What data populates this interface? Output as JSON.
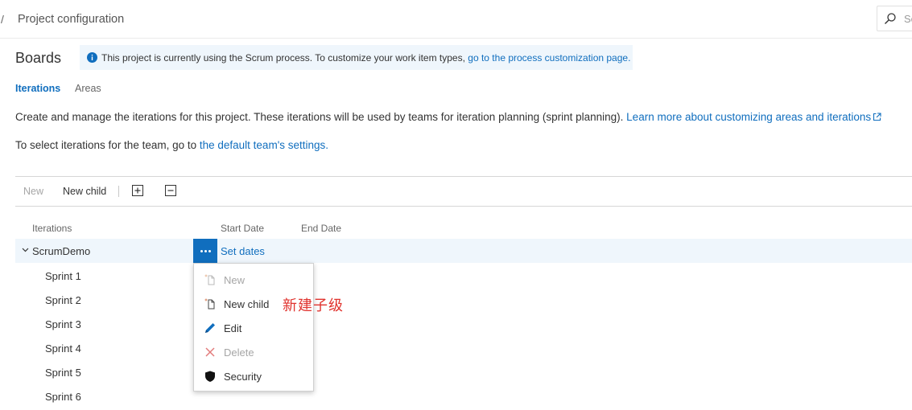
{
  "header": {
    "breadcrumb_separator": "/",
    "title": "Project configuration",
    "search_placeholder": "Se"
  },
  "page_title": "Boards",
  "info_bar": {
    "text": "This project is currently using the Scrum process. To customize your work item types, ",
    "link": "go to the process customization page."
  },
  "tabs": [
    {
      "label": "Iterations",
      "active": true
    },
    {
      "label": "Areas",
      "active": false
    }
  ],
  "description": {
    "line1_text": "Create and manage the iterations for this project. These iterations will be used by teams for iteration planning (sprint planning). ",
    "line1_link": "Learn more about customizing areas and iterations",
    "line2_text": "To select iterations for the team, go to ",
    "line2_link": "the default team's settings."
  },
  "toolbar": {
    "new_label": "New",
    "new_child_label": "New child",
    "expand_icon": "expand-all-icon",
    "collapse_icon": "collapse-all-icon"
  },
  "columns": {
    "iterations": "Iterations",
    "start_date": "Start Date",
    "end_date": "End Date"
  },
  "root": {
    "label": "ScrumDemo",
    "set_dates": "Set dates"
  },
  "sprints": [
    "Sprint 1",
    "Sprint 2",
    "Sprint 3",
    "Sprint 4",
    "Sprint 5",
    "Sprint 6"
  ],
  "context_menu": [
    {
      "label": "New",
      "icon": "new-item-icon",
      "disabled": true
    },
    {
      "label": "New child",
      "icon": "new-child-icon",
      "disabled": false
    },
    {
      "label": "Edit",
      "icon": "pencil-icon",
      "disabled": false
    },
    {
      "label": "Delete",
      "icon": "delete-x-icon",
      "disabled": true
    },
    {
      "label": "Security",
      "icon": "shield-icon",
      "disabled": false
    }
  ],
  "annotation": "新建子级",
  "colors": {
    "accent": "#106ebe",
    "info_bg": "#eff6fc",
    "annotation": "#e0332e",
    "delete": "#e27c7c"
  }
}
